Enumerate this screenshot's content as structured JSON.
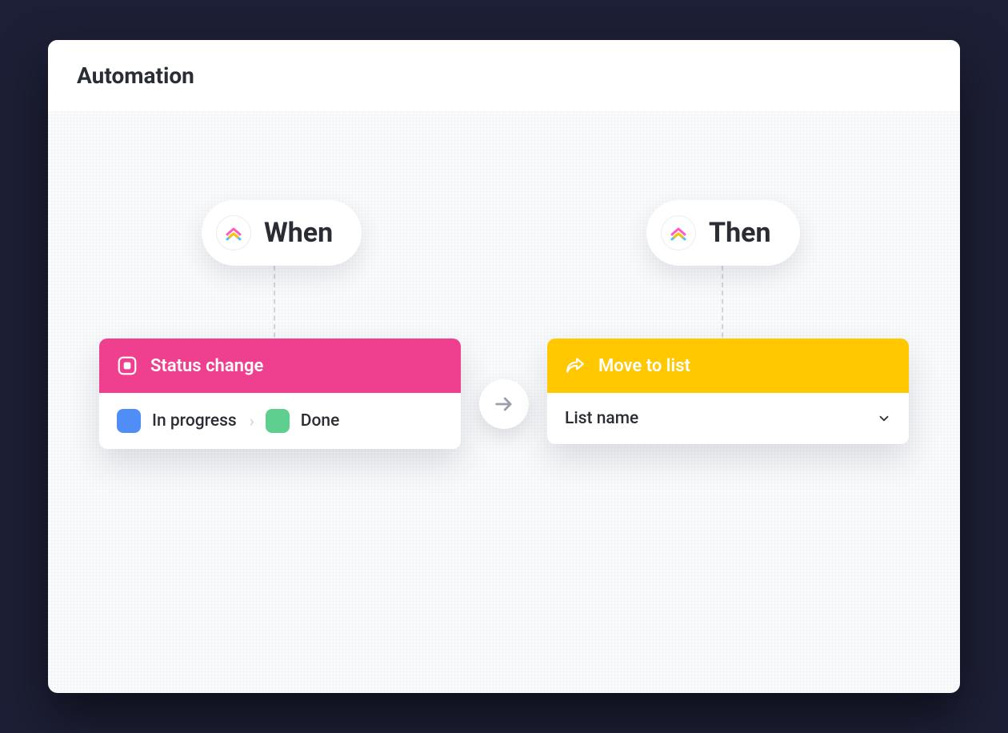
{
  "header": {
    "title": "Automation"
  },
  "pills": {
    "when": "When",
    "then": "Then"
  },
  "when_card": {
    "title": "Status change",
    "from_status": "In progress",
    "to_status": "Done",
    "from_color": "#4f8ef7",
    "to_color": "#5fcf8f",
    "header_color": "#ef3f8f"
  },
  "then_card": {
    "title": "Move to list",
    "list_label": "List name",
    "header_color": "#ffc800"
  }
}
